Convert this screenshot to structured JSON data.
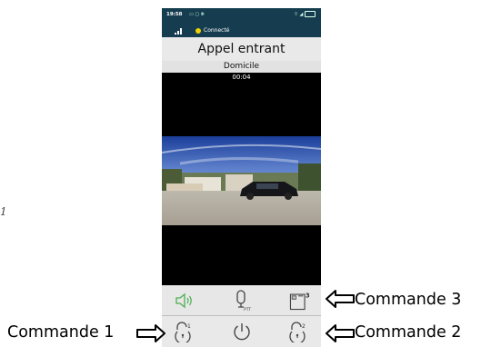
{
  "status_bar": {
    "time": "19:58",
    "connection_label": "Connecté"
  },
  "call": {
    "title": "Appel entrant",
    "location": "Domicile",
    "duration": "00:04"
  },
  "controls": {
    "speaker": {
      "icon": "speaker-icon"
    },
    "push_to_talk": {
      "icon": "microphone-icon",
      "label": "PTT"
    },
    "command_3": {
      "icon": "gate-icon",
      "number": "3"
    },
    "command_1": {
      "icon": "lock-open-icon",
      "number": "1"
    },
    "power": {
      "icon": "power-icon"
    },
    "command_2": {
      "icon": "lock-open-icon",
      "number": "2"
    }
  },
  "annotations": {
    "command_3": "Commande 3",
    "command_1": "Commande 1",
    "command_2": "Commande 2"
  },
  "colors": {
    "status_bar_bg": "#153d4f",
    "connected_dot": "#f1d000",
    "speaker_green": "#4caf50"
  }
}
